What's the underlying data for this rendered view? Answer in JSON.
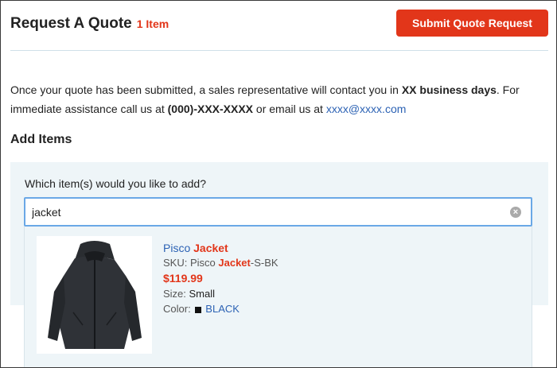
{
  "header": {
    "title": "Request A Quote",
    "item_count": "1 Item",
    "submit_label": "Submit Quote Request"
  },
  "description": {
    "part1": "Once your quote has been submitted, a sales representative will contact you in ",
    "days": "XX business days",
    "part2": ". For immediate assistance call us at ",
    "phone": "(000)-XXX-XXXX",
    "part3": " or email us at ",
    "email": "xxxx@xxxx.com"
  },
  "add_items": {
    "heading": "Add Items",
    "question": "Which item(s) would you like to add?",
    "search_value": "jacket",
    "clear_icon": "×"
  },
  "result": {
    "name_prefix": "Pisco ",
    "name_match": "Jacket",
    "sku_label": "SKU: ",
    "sku_prefix": "Pisco ",
    "sku_match": "Jacket",
    "sku_suffix": "-S-BK",
    "price": "$119.99",
    "size_label": "Size: ",
    "size_value": "Small",
    "color_label": "Color: ",
    "color_value": "BLACK",
    "image_icon": "jacket-image"
  },
  "colors": {
    "accent": "#e2361a",
    "link": "#2c62b4",
    "panel_bg": "#eef5f8",
    "focus_border": "#6aa8e6"
  }
}
